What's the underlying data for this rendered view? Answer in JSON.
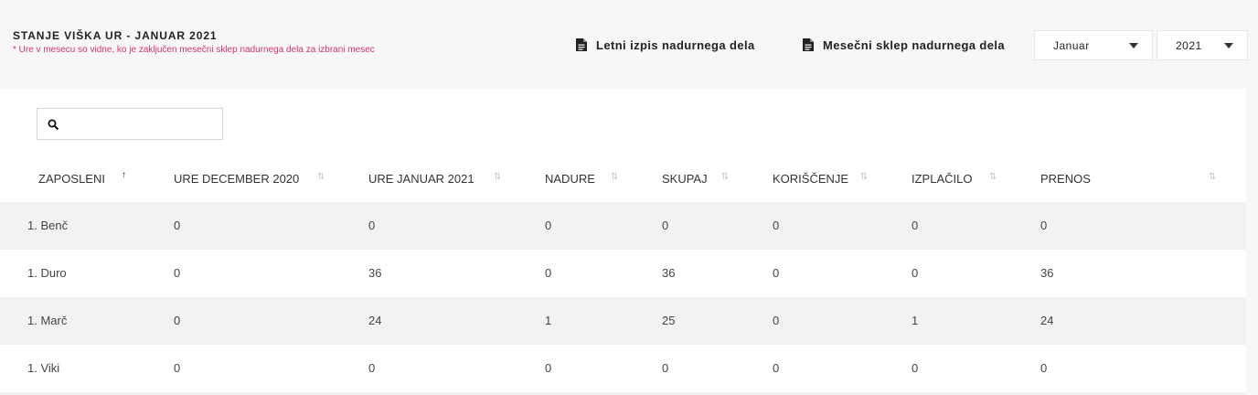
{
  "header": {
    "title": "STANJE VIŠKA UR - JANUAR 2021",
    "note": "* Ure v mesecu so vidne, ko je zaključen mesečni sklep nadurnega dela za izbrani mesec",
    "action_yearly": "Letni izpis nadurnega dela",
    "action_monthly": "Mesečni sklep nadurnega dela",
    "month_select": "Januar",
    "year_select": "2021"
  },
  "search": {
    "value": "",
    "placeholder": ""
  },
  "table": {
    "columns": [
      "ZAPOSLENI",
      "URE DECEMBER 2020",
      "URE JANUAR 2021",
      "NADURE",
      "SKUPAJ",
      "KORIŠČENJE",
      "IZPLAČILO",
      "PRENOS"
    ],
    "sort_active": "ZAPOSLENI",
    "rows": [
      [
        "1. Benč",
        "0",
        "0",
        "0",
        "0",
        "0",
        "0",
        "0"
      ],
      [
        "1. Duro",
        "0",
        "36",
        "0",
        "36",
        "0",
        "0",
        "36"
      ],
      [
        "1. Marč",
        "0",
        "24",
        "1",
        "25",
        "0",
        "1",
        "24"
      ],
      [
        "1. Viki",
        "0",
        "0",
        "0",
        "0",
        "0",
        "0",
        "0"
      ]
    ]
  },
  "icons": {
    "document": "file-text-icon",
    "search": "search-icon",
    "sort": "sort-arrows-icon",
    "caret": "caret-down-icon"
  }
}
